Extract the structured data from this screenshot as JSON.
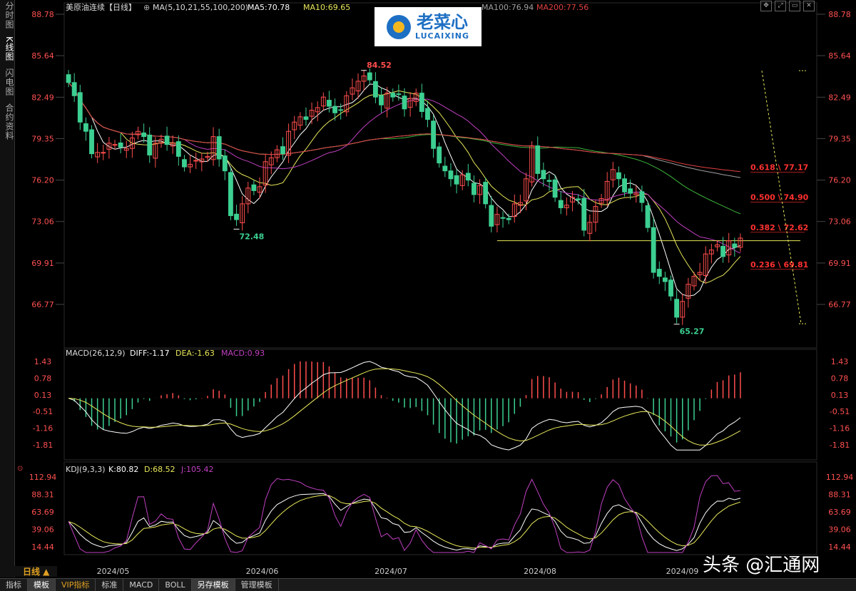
{
  "sidebar": {
    "tabs": [
      {
        "label": "分时图",
        "active": false
      },
      {
        "label": "K线图",
        "active": true
      },
      {
        "label": "闪电图",
        "active": false
      },
      {
        "label": "合约资料",
        "active": false
      }
    ]
  },
  "header": {
    "instrument": "美原油连续【日线】",
    "ma_label": "MA(5,10,21,55,100,200)",
    "ma5": "MA5:70.78",
    "ma10": "MA10:69.65",
    "ma100": "MA100:76.94",
    "ma200": "MA200:77.56"
  },
  "logo": {
    "cn": "老菜心",
    "en": "LUCAIXING"
  },
  "macd_header": {
    "label": "MACD(26,12,9)",
    "diff": "DIFF:-1.17",
    "dea": "DEA:-1.63",
    "macd": "MACD:0.93"
  },
  "kdj_header": {
    "label": "KDJ(9,3,3)",
    "k": "K:80.82",
    "d": "D:68.52",
    "j": "J:105.42"
  },
  "period_button": "日线 ▲",
  "bottom_tabs": [
    {
      "label": "指标",
      "active": false,
      "vip": false
    },
    {
      "label": "模板",
      "active": true,
      "vip": false
    },
    {
      "label": "VIP指标",
      "active": false,
      "vip": true
    },
    {
      "label": "标准",
      "active": false,
      "vip": false
    },
    {
      "label": "MACD",
      "active": false,
      "vip": false
    },
    {
      "label": "BOLL",
      "active": false,
      "vip": false
    },
    {
      "label": "另存模板",
      "active": true,
      "vip": false
    },
    {
      "label": "管理模板",
      "active": false,
      "vip": false
    }
  ],
  "watermark": "头条 @汇通网",
  "colors": {
    "up": "#ff4d4d",
    "down": "#3ccf91",
    "ma5": "#ffffff",
    "ma10": "#e8e85a",
    "ma21": "#c040c0",
    "ma55": "#3cb43c",
    "ma100": "#a0a0a0",
    "ma200": "#e04040",
    "fib": "#ff3030",
    "axis_text": "#ff5050"
  },
  "chart_data": [
    {
      "type": "candlestick",
      "title": "美原油连续【日线】",
      "ylim": [
        65.27,
        88.78
      ],
      "yticks": [
        88.78,
        85.64,
        82.49,
        79.35,
        76.2,
        73.06,
        69.91,
        66.77
      ],
      "ytick_labels": [
        "88.78",
        "85.64",
        "82.49",
        "79.35",
        "76.20",
        "73.06",
        "69.91",
        "66.77"
      ],
      "x_labels": [
        "2024/05",
        "2024/06",
        "2024/07",
        "2024/08",
        "2024/09"
      ],
      "close": [
        83.6,
        82.6,
        80.6,
        79.9,
        78.2,
        78.3,
        78.3,
        79.0,
        78.9,
        78.7,
        78.6,
        79.4,
        79.9,
        79.5,
        78.1,
        79.0,
        79.3,
        78.9,
        79.0,
        78.0,
        77.2,
        77.4,
        77.7,
        77.8,
        78.0,
        79.5,
        77.8,
        76.9,
        73.5,
        73.2,
        74.4,
        75.6,
        75.4,
        75.7,
        77.6,
        77.9,
        78.5,
        78.2,
        79.9,
        80.6,
        81.0,
        80.8,
        81.5,
        81.7,
        82.5,
        81.8,
        81.3,
        81.5,
        82.6,
        83.2,
        83.7,
        84.1,
        83.8,
        82.5,
        81.9,
        82.8,
        82.5,
        82.7,
        81.6,
        82.4,
        82.8,
        81.4,
        80.8,
        78.6,
        77.5,
        76.9,
        76.3,
        75.9,
        76.6,
        76.2,
        75.1,
        75.8,
        74.4,
        72.7,
        73.6,
        73.3,
        73.2,
        74.4,
        74.5,
        76.3,
        78.8,
        76.7,
        76.3,
        76.1,
        74.9,
        74.1,
        74.3,
        74.9,
        74.7,
        72.4,
        73.0,
        74.2,
        74.8,
        76.1,
        77.0,
        76.3,
        75.3,
        75.2,
        75.2,
        74.5,
        72.6,
        69.2,
        68.9,
        68.5,
        67.4,
        65.8,
        67.0,
        68.3,
        68.9,
        69.2,
        70.6,
        70.9,
        71.3,
        70.4,
        71.6,
        71.1,
        71.8
      ],
      "annotations": [
        {
          "text": "84.52",
          "kind": "high"
        },
        {
          "text": "72.48",
          "kind": "low"
        },
        {
          "text": "65.27",
          "kind": "low"
        }
      ],
      "fibonacci": [
        {
          "label": "0.618 \\ 77.17",
          "value": 77.17
        },
        {
          "label": "0.500 \\ 74.90",
          "value": 74.9
        },
        {
          "label": "0.382 \\ 72.62",
          "value": 72.62
        },
        {
          "label": "0.236 \\ 69.81",
          "value": 69.81
        }
      ],
      "horizontal_line": 71.6,
      "series": [
        {
          "name": "MA5",
          "value_label": "70.78"
        },
        {
          "name": "MA10",
          "value_label": "69.65"
        },
        {
          "name": "MA21"
        },
        {
          "name": "MA55"
        },
        {
          "name": "MA100",
          "value_label": "76.94"
        },
        {
          "name": "MA200",
          "value_label": "77.56"
        }
      ]
    },
    {
      "type": "bar",
      "title": "MACD(26,12,9)",
      "ylim": [
        -1.81,
        1.43
      ],
      "yticks": [
        1.43,
        0.78,
        0.13,
        -0.51,
        -1.16,
        -1.81
      ],
      "ytick_labels": [
        "1.43",
        "0.78",
        "0.13",
        "-0.51",
        "-1.16",
        "-1.81"
      ],
      "series": [
        {
          "name": "DIFF",
          "last": -1.17
        },
        {
          "name": "DEA",
          "last": -1.63
        },
        {
          "name": "MACD",
          "last": 0.93
        }
      ]
    },
    {
      "type": "line",
      "title": "KDJ(9,3,3)",
      "ylim": [
        14.44,
        112.94
      ],
      "yticks": [
        112.94,
        88.31,
        63.69,
        39.06,
        14.44
      ],
      "ytick_labels": [
        "112.94",
        "88.31",
        "63.69",
        "39.06",
        "14.44"
      ],
      "series": [
        {
          "name": "K",
          "last": 80.82
        },
        {
          "name": "D",
          "last": 68.52
        },
        {
          "name": "J",
          "last": 105.42
        }
      ]
    }
  ]
}
